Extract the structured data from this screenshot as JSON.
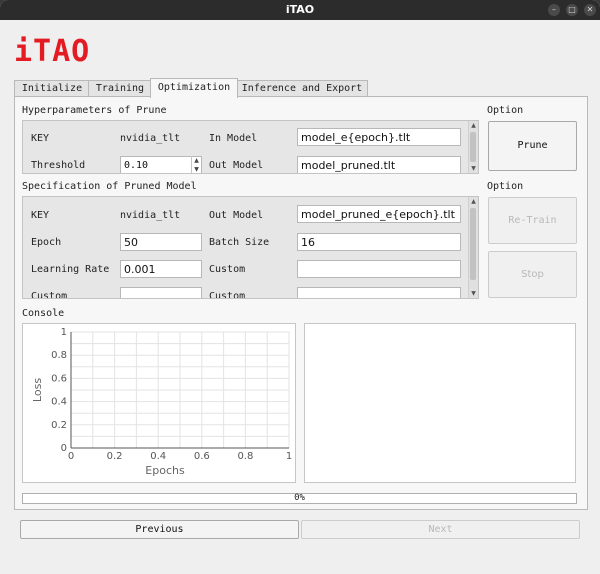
{
  "window": {
    "title": "iTAO"
  },
  "logo": "iTAO",
  "tabs": [
    {
      "label": "Initialize"
    },
    {
      "label": "Training"
    },
    {
      "label": "Optimization"
    },
    {
      "label": "Inference and Export"
    }
  ],
  "active_tab": "Optimization",
  "prune": {
    "section_label": "Hyperparameters of Prune",
    "key_label": "KEY",
    "key_value": "nvidia_tlt",
    "in_model_label": "In Model",
    "in_model_value": "model_e{epoch}.tlt",
    "threshold_label": "Threshold",
    "threshold_value": "0.10",
    "out_model_label": "Out Model",
    "out_model_value": "model_pruned.tlt"
  },
  "prune_option": {
    "label": "Option",
    "prune_button": "Prune"
  },
  "spec": {
    "section_label": "Specification of Pruned Model",
    "key_label": "KEY",
    "key_value": "nvidia_tlt",
    "out_model_label": "Out Model",
    "out_model_value": "model_pruned_e{epoch}.tlt",
    "epoch_label": "Epoch",
    "epoch_value": "50",
    "batch_size_label": "Batch Size",
    "batch_size_value": "16",
    "learning_rate_label": "Learning Rate",
    "learning_rate_value": "0.001",
    "custom_label_1": "Custom",
    "custom_value_1": "",
    "custom_label_2": "Custom",
    "custom_label_3": "Custom"
  },
  "spec_option": {
    "label": "Option",
    "retrain_button": "Re-Train",
    "stop_button": "Stop"
  },
  "console": {
    "label": "Console"
  },
  "chart_data": {
    "type": "line",
    "xlabel": "Epochs",
    "ylabel": "Loss",
    "xlim": [
      0,
      1
    ],
    "ylim": [
      0,
      1
    ],
    "x_ticks": [
      "0",
      "0.2",
      "0.4",
      "0.6",
      "0.8",
      "1"
    ],
    "y_ticks": [
      "0",
      "0.2",
      "0.4",
      "0.6",
      "0.8",
      "1"
    ],
    "grid": true,
    "series": []
  },
  "progress": {
    "value": 0,
    "text": "0%"
  },
  "nav": {
    "previous": "Previous",
    "next": "Next"
  },
  "colors": {
    "logo": "#e31b23",
    "titlebar": "#2c2c2c"
  },
  "icons": {
    "minimize": "minimize-icon",
    "maximize": "maximize-icon",
    "close": "close-icon"
  }
}
